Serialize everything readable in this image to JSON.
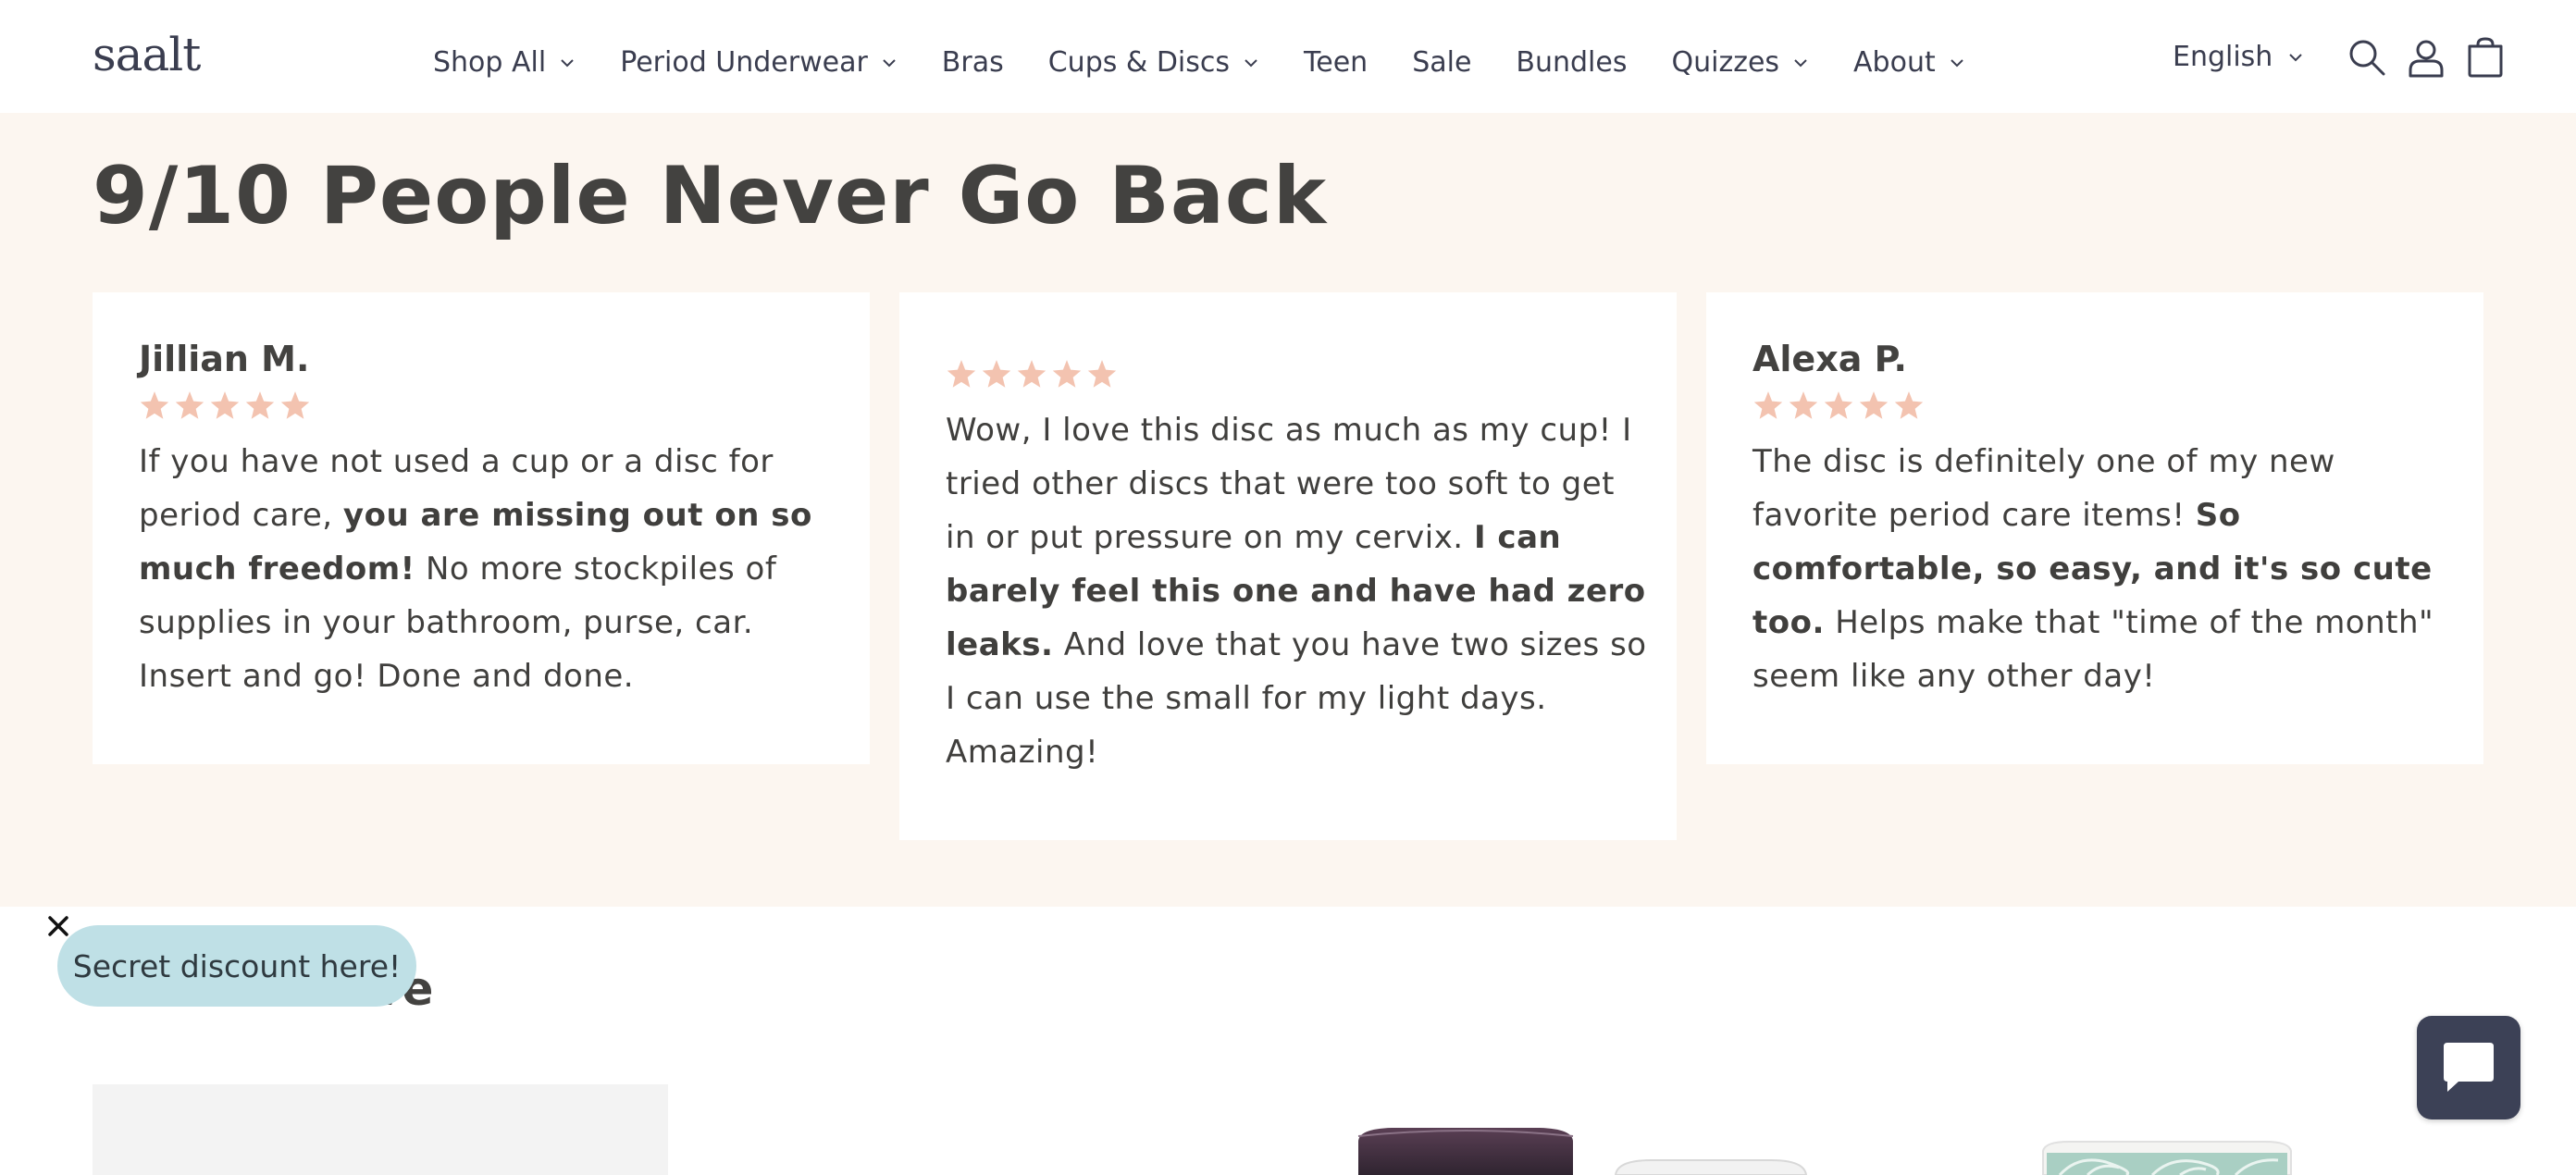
{
  "header": {
    "logo": "saalt",
    "nav": [
      {
        "label": "Shop All",
        "dropdown": true
      },
      {
        "label": "Period Underwear",
        "dropdown": true
      },
      {
        "label": "Bras",
        "dropdown": false
      },
      {
        "label": "Cups & Discs",
        "dropdown": true
      },
      {
        "label": "Teen",
        "dropdown": false
      },
      {
        "label": "Sale",
        "dropdown": false
      },
      {
        "label": "Bundles",
        "dropdown": false
      },
      {
        "label": "Quizzes",
        "dropdown": true
      },
      {
        "label": "About",
        "dropdown": true
      }
    ],
    "language": "English",
    "icons": [
      "search-icon",
      "account-icon",
      "cart-icon"
    ]
  },
  "reviews": {
    "title": "9/10 People Never Go Back",
    "star_color": "#f3c3b0",
    "background": "#fcf6f0",
    "cards": [
      {
        "name": "Jillian M.",
        "rating": 5,
        "text_before": "If you have not used a cup or a disc for period care, ",
        "text_bold": "you are missing out on so much freedom!",
        "text_after": " No more stockpiles of supplies in your bathroom, purse, car. Insert and go! Done and done."
      },
      {
        "name": "",
        "rating": 5,
        "text_before": "Wow, I love this disc as much as my cup! I tried other discs that were too soft to get in or put pressure on my cervix. ",
        "text_bold": "I can barely feel this one and have had zero leaks.",
        "text_after": " And love that you have two sizes so I can use the small for my light days. Amazing!"
      },
      {
        "name": "Alexa P.",
        "rating": 5,
        "text_before": "The disc is definitely one of my new favorite period care items! ",
        "text_bold": "So comfortable, so easy, and it's so cute too.",
        "text_after": " Helps make that \"time of the month\" seem like any other day!"
      }
    ]
  },
  "more": {
    "title": "More to Love"
  },
  "popup": {
    "label": "Secret discount here!"
  },
  "chat": {
    "icon": "chat-icon",
    "color": "#3c4156"
  }
}
